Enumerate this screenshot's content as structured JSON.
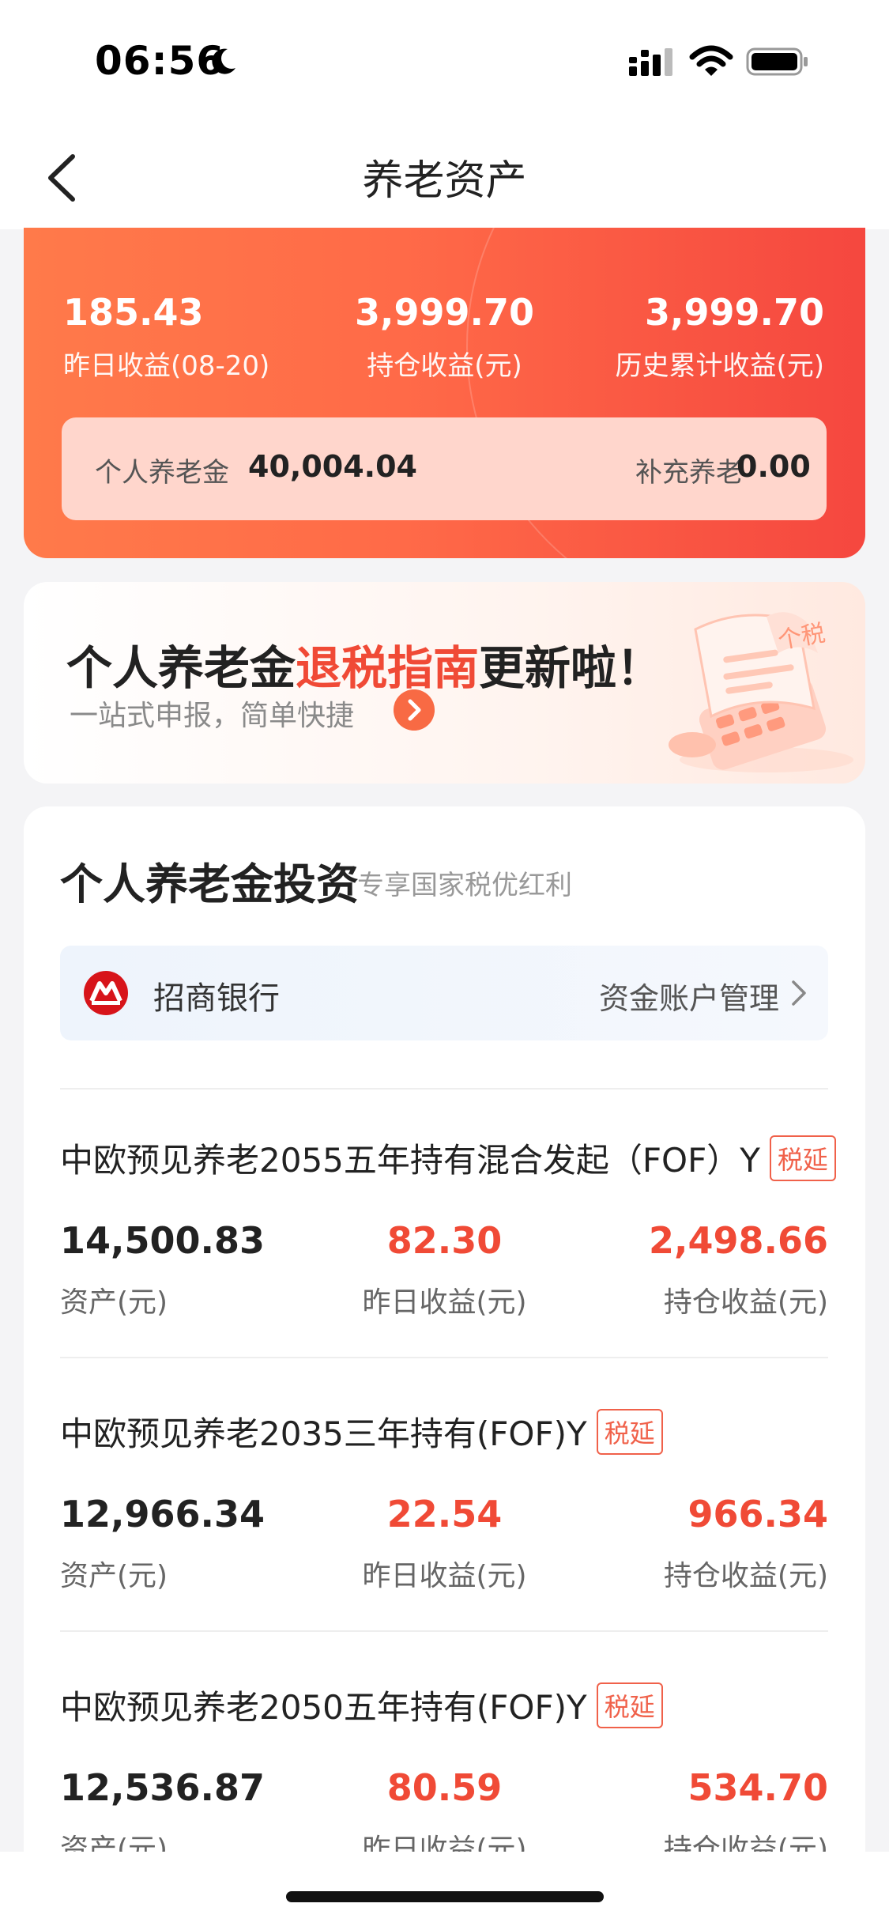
{
  "status": {
    "time": "06:56"
  },
  "nav": {
    "title": "养老资产"
  },
  "summary": {
    "yesterday_value": "185.43",
    "yesterday_label": "昨日收益(08-20)",
    "holding_value": "3,999.70",
    "holding_label": "持仓收益(元)",
    "history_value": "3,999.70",
    "history_label": "历史累计收益(元)",
    "personal_pension_label": "个人养老金",
    "personal_pension_value": "40,004.04",
    "supplementary_label": "补充养老",
    "supplementary_value": "0.00"
  },
  "banner": {
    "title_prefix": "个人养老金",
    "title_highlight": "退税指南",
    "title_suffix": "更新啦！",
    "subtitle": "一站式申报，简单快捷",
    "illustration_text": "个税"
  },
  "invest": {
    "title": "个人养老金投资",
    "subtitle": "专享国家税优红利",
    "bank_name": "招商银行",
    "bank_manage": "资金账户管理"
  },
  "funds": [
    {
      "name": "中欧预见养老2055五年持有混合发起（FOF）Y",
      "badge": "税延",
      "asset": "14,500.83",
      "asset_label": "资产(元)",
      "yesterday": "82.30",
      "yesterday_label": "昨日收益(元)",
      "holding": "2,498.66",
      "holding_label": "持仓收益(元)"
    },
    {
      "name": "中欧预见养老2035三年持有(FOF)Y",
      "badge": "税延",
      "asset": "12,966.34",
      "asset_label": "资产(元)",
      "yesterday": "22.54",
      "yesterday_label": "昨日收益(元)",
      "holding": "966.34",
      "holding_label": "持仓收益(元)"
    },
    {
      "name": "中欧预见养老2050五年持有(FOF)Y",
      "badge": "税延",
      "asset": "12,536.87",
      "asset_label": "资产(元)",
      "yesterday": "80.59",
      "yesterday_label": "昨日收益(元)",
      "holding": "534.70",
      "holding_label": "持仓收益(元)"
    }
  ],
  "colors": {
    "accent": "#f04a36",
    "card_gradient_start": "#ff7a4a",
    "card_gradient_end": "#f5473f"
  }
}
